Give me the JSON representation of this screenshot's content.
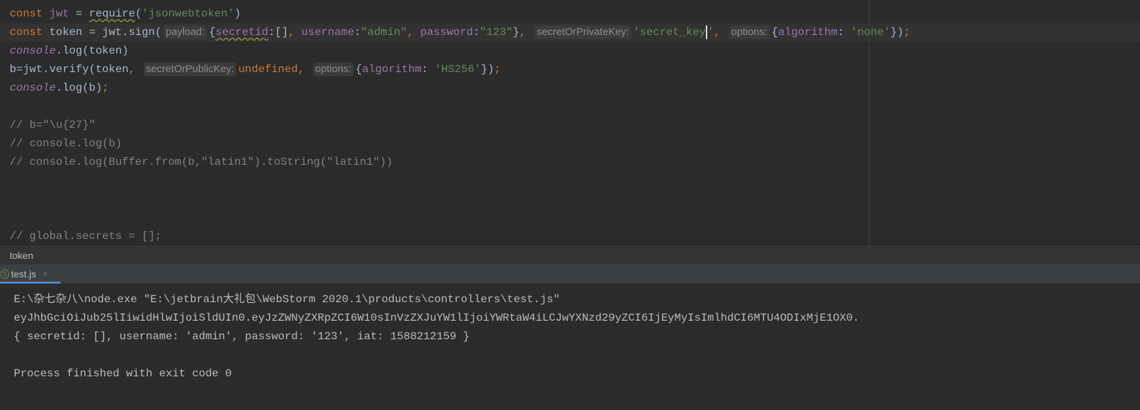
{
  "editor": {
    "lines": [
      [
        [
          "const ",
          "kw"
        ],
        [
          "jwt",
          "pur"
        ],
        [
          " = ",
          "pl"
        ],
        [
          "require",
          "pl und"
        ],
        [
          "(",
          "pl"
        ],
        [
          "'jsonwebtoken'",
          "str"
        ],
        [
          ")",
          "pl"
        ]
      ],
      [
        [
          "const ",
          "kw"
        ],
        [
          "token = jwt.sign(",
          "pl"
        ],
        [
          "payload:",
          "hint"
        ],
        [
          "{",
          "pl"
        ],
        [
          "secretid",
          "pur und"
        ],
        [
          ":[]",
          "pl"
        ],
        [
          ", ",
          "kw"
        ],
        [
          "username",
          "pur"
        ],
        [
          ":",
          "pl"
        ],
        [
          "\"admin\"",
          "str"
        ],
        [
          ", ",
          "kw"
        ],
        [
          "password",
          "pur"
        ],
        [
          ":",
          "pl"
        ],
        [
          "\"123\"",
          "str"
        ],
        [
          "}",
          "pl"
        ],
        [
          ", ",
          "kw"
        ],
        [
          "secretOrPrivateKey:",
          "hint"
        ],
        [
          "'secret_key",
          "str"
        ],
        [
          "",
          "caret"
        ],
        [
          "'",
          "str"
        ],
        [
          ", ",
          "kw"
        ],
        [
          "options:",
          "hint"
        ],
        [
          "{",
          "pl"
        ],
        [
          "algorithm",
          "pur"
        ],
        [
          ": ",
          "pl"
        ],
        [
          "'none'",
          "str"
        ],
        [
          "})",
          "pl"
        ],
        [
          ";",
          "kw"
        ]
      ],
      [
        [
          "console",
          "it"
        ],
        [
          ".log(token)",
          "pl"
        ]
      ],
      [
        [
          "b=jwt.verify(token",
          "pl"
        ],
        [
          ", ",
          "kw"
        ],
        [
          "secretOrPublicKey:",
          "hint"
        ],
        [
          "undefined",
          "kw"
        ],
        [
          ", ",
          "kw"
        ],
        [
          "options:",
          "hint"
        ],
        [
          "{",
          "pl"
        ],
        [
          "algorithm",
          "pur"
        ],
        [
          ": ",
          "pl"
        ],
        [
          "'HS256'",
          "str"
        ],
        [
          "})",
          "pl"
        ],
        [
          ";",
          "kw"
        ]
      ],
      [
        [
          "console",
          "it"
        ],
        [
          ".log(b)",
          "pl"
        ],
        [
          ";",
          "kw"
        ]
      ],
      [],
      [
        [
          "// b=\"\\u{27}\"",
          "cm"
        ]
      ],
      [
        [
          "// console.log(b)",
          "cm"
        ]
      ],
      [
        [
          "// console.log(Buffer.from(b,\"latin1\").toString(\"latin1\"))",
          "cm"
        ]
      ],
      [],
      [],
      [],
      [
        [
          "// global.secrets = [];",
          "cm"
        ]
      ]
    ]
  },
  "breadcrumb": "token",
  "run_tab": {
    "label": "test.js",
    "icon": "nodejs-icon",
    "close": "×"
  },
  "console": {
    "lines": [
      "E:\\杂七杂八\\node.exe \"E:\\jetbrain大礼包\\WebStorm 2020.1\\products\\controllers\\test.js\"",
      "eyJhbGciOiJub25lIiwidHlwIjoiSldUIn0.eyJzZWNyZXRpZCI6W10sInVzZXJuYW1lIjoiYWRtaW4iLCJwYXNzd29yZCI6IjEyMyIsImlhdCI6MTU4ODIxMjE1OX0.",
      "{ secretid: [], username: 'admin', password: '123', iat: 1588212159 }",
      "",
      "Process finished with exit code 0"
    ]
  }
}
